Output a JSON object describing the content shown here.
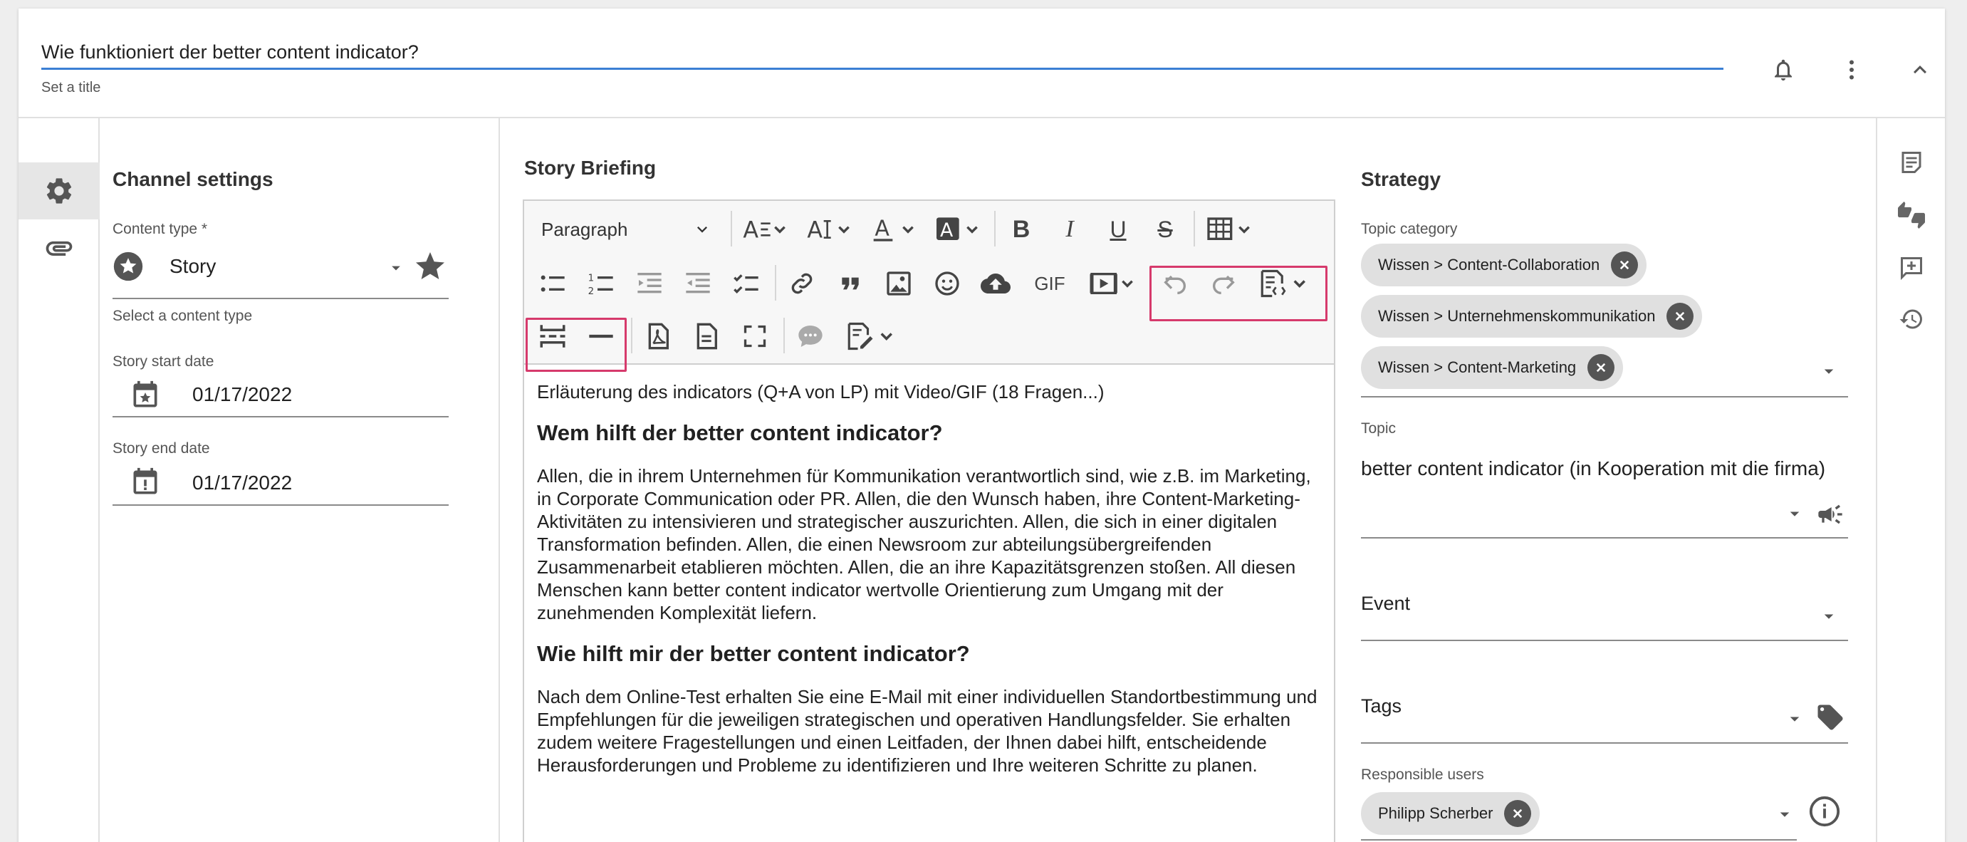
{
  "header": {
    "title_value": "Wie funktioniert der better content indicator?",
    "title_hint": "Set a title"
  },
  "channel": {
    "title": "Channel settings",
    "content_type_label": "Content type *",
    "content_type_value": "Story",
    "content_type_hint": "Select a content type",
    "start_label": "Story start date",
    "start_value": "01/17/2022",
    "end_label": "Story end date",
    "end_value": "01/17/2022"
  },
  "editor": {
    "title": "Story Briefing",
    "paragraph_select": "Paragraph",
    "gif_label": "GIF",
    "intro": "Erläuterung des indicators (Q+A von LP) mit Video/GIF (18 Fragen...)",
    "h1": "Wem hilft der better content indicator?",
    "p1": "Allen, die in ihrem Unternehmen für Kommunikation verantwortlich sind, wie z.B. im Marketing, in Corporate Communication oder PR. Allen, die den Wunsch haben, ihre Content-Marketing-Aktivitäten zu intensivieren und strategischer auszurichten. Allen, die sich in einer digitalen Transformation befinden. Allen, die einen Newsroom zur abteilungsübergreifenden Zusammenarbeit etablieren möchten. Allen, die an ihre Kapazitätsgrenzen stoßen. All diesen Menschen kann better content indicator wertvolle Orientierung zum Umgang mit der zunehmenden Komplexität liefern.",
    "h2": "Wie hilft mir der better content indicator?",
    "p2": "Nach dem Online-Test erhalten Sie eine E-Mail mit einer individuellen Standortbestimmung und Empfehlungen für die jeweiligen strategischen und operativen Handlungsfelder. Sie erhalten zudem weitere Fragestellungen und einen Leitfaden, der Ihnen dabei hilft, entscheidende Herausforderungen und Probleme zu identifizieren und Ihre weiteren Schritte zu planen."
  },
  "strategy": {
    "title": "Strategy",
    "topic_category_label": "Topic category",
    "chips": [
      "Wissen > Content-Collaboration",
      "Wissen > Unternehmenskommunikation",
      "Wissen > Content-Marketing"
    ],
    "topic_label": "Topic",
    "topic_value": "better content indicator (in Kooperation mit die firma)",
    "event_label": "Event",
    "tags_label": "Tags",
    "users_label": "Responsible users",
    "user_chip": "Philipp Scherber"
  },
  "colors": {
    "accent": "#3b7fd4",
    "highlight": "#d63a6c",
    "icon": "#555555"
  }
}
